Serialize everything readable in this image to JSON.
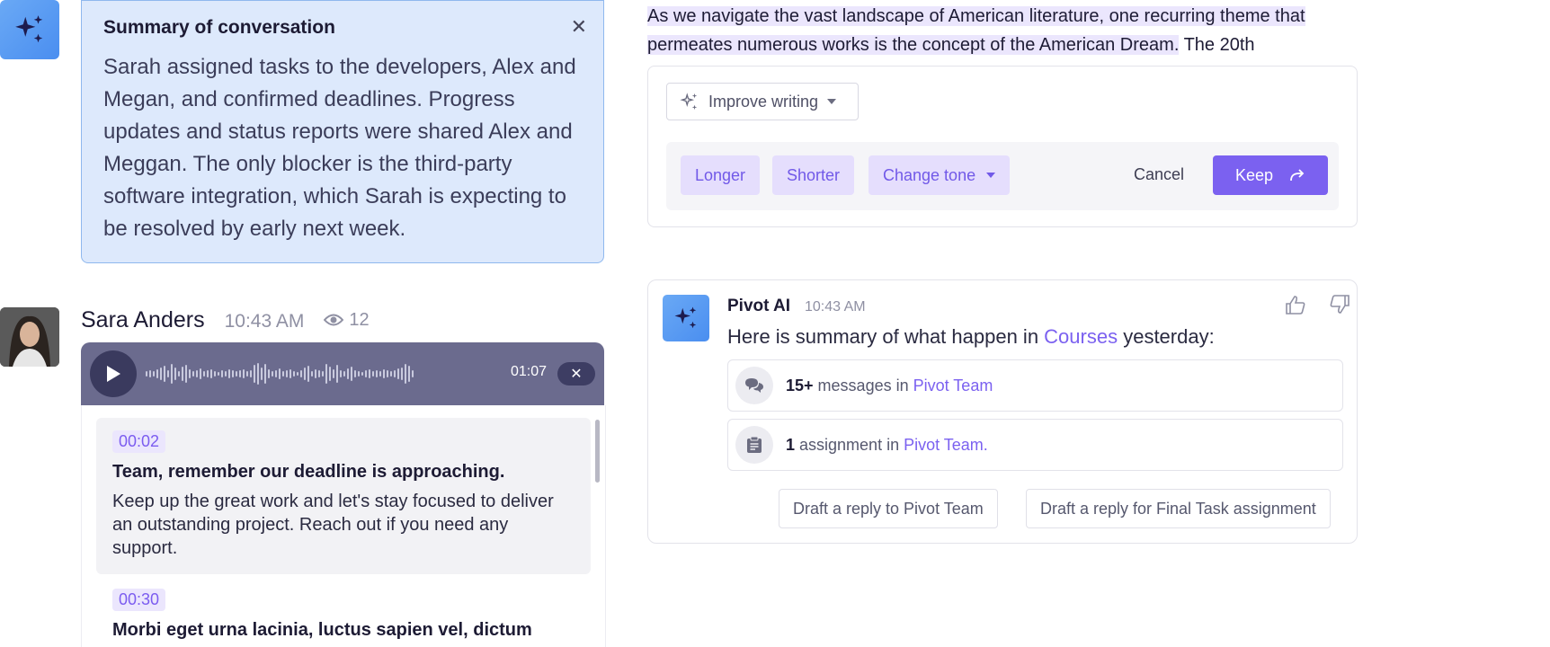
{
  "summary": {
    "title": "Summary of conversation",
    "body": "Sarah assigned tasks to the developers, Alex and Megan, and confirmed deadlines. Progress updates and status reports were shared Alex and Meggan. The only blocker is the third-party software integration, which Sarah is expecting to be resolved by early next week."
  },
  "voice_message": {
    "sender": "Sara Anders",
    "time": "10:43 AM",
    "views": "12",
    "duration": "01:07",
    "transcript": [
      {
        "timestamp": "00:02",
        "title": "Team, remember our deadline is approaching.",
        "body": "Keep up the great work and let's stay focused to deliver an outstanding project. Reach out if you need any support."
      },
      {
        "timestamp": "00:30",
        "title": "Morbi eget urna lacinia, luctus sapien vel, dictum",
        "body": ""
      }
    ]
  },
  "writing_assistant": {
    "highlighted_text": "As we navigate the vast landscape of American literature, one recurring theme that permeates numerous works is the concept of the American Dream.",
    "trailing_text": " The 20th",
    "mode_selector": "Improve writing",
    "options": [
      "Longer",
      "Shorter",
      "Change tone"
    ],
    "cancel_label": "Cancel",
    "keep_label": "Keep"
  },
  "pivot_ai": {
    "name": "Pivot AI",
    "time": "10:43 AM",
    "message_prefix": "Here is summary of what happen in ",
    "message_link": "Courses",
    "message_suffix": " yesterday:",
    "stats": [
      {
        "count": "15+",
        "text": " messages in ",
        "link": "Pivot Team",
        "icon": "chat-bubbles-icon"
      },
      {
        "count": "1",
        "text": " assignment in ",
        "link": "Pivot Team.",
        "icon": "clipboard-icon"
      }
    ],
    "replies": [
      "Draft a reply to Pivot Team",
      "Draft a reply for Final Task assignment"
    ]
  },
  "colors": {
    "accent": "#7b61f0",
    "summary_bg": "#dde9fc",
    "player_bg": "#6b6b8e",
    "ai_avatar": "#4a8ef0"
  }
}
